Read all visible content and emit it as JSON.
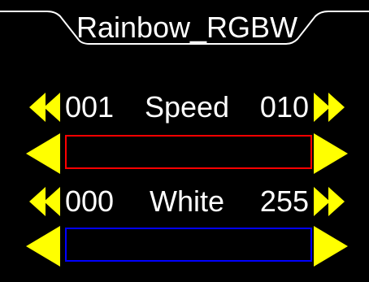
{
  "title": "Rainbow_RGBW",
  "colors": {
    "accent": "#ffff00",
    "text": "#ffffff",
    "background": "#000000",
    "speed_bar_border": "#ff0000",
    "white_bar_border": "#0000ff"
  },
  "controls": [
    {
      "name": "Speed",
      "min": "001",
      "max": "010",
      "bar_color": "#ff0000",
      "level": 0,
      "coarse_left_icon": "double-chevron-left-icon",
      "coarse_right_icon": "double-chevron-right-icon",
      "fine_left_icon": "triangle-left-icon",
      "fine_right_icon": "triangle-right-icon"
    },
    {
      "name": "White",
      "min": "000",
      "max": "255",
      "bar_color": "#0000ff",
      "level": 0,
      "coarse_left_icon": "double-chevron-left-icon",
      "coarse_right_icon": "double-chevron-right-icon",
      "fine_left_icon": "triangle-left-icon",
      "fine_right_icon": "triangle-right-icon"
    }
  ]
}
